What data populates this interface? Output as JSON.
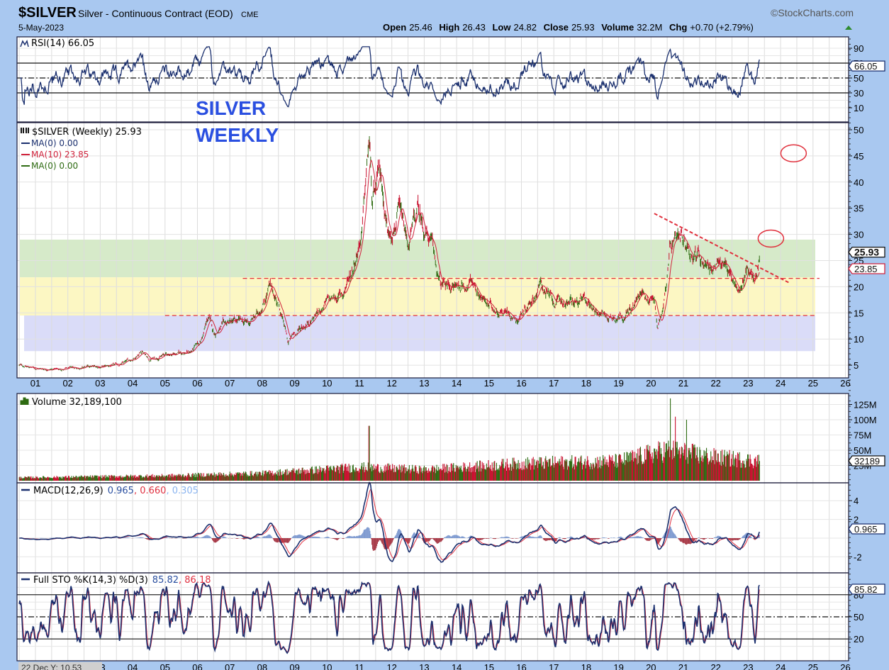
{
  "header": {
    "symbol": "$SILVER",
    "name": "Silver - Continuous Contract (EOD)",
    "exchange": "CME",
    "date": "5-May-2023",
    "copyright": "©StockCharts.com",
    "open_label": "Open",
    "open": "25.46",
    "high_label": "High",
    "high": "26.43",
    "low_label": "Low",
    "low": "24.82",
    "close_label": "Close",
    "close": "25.93",
    "volume_label": "Volume",
    "volume": "32.2M",
    "chg_label": "Chg",
    "chg": "+0.70 (+2.79%)"
  },
  "annotation": {
    "line1": "SILVER",
    "line2": "WEEKLY"
  },
  "legends": {
    "rsi": "RSI(14) 66.05",
    "price": "$SILVER (Weekly) 25.93",
    "ma1": "MA(0) 0.00",
    "ma2": "MA(10) 23.85",
    "ma3": "MA(0) 0.00",
    "volume": "Volume 32,189,100",
    "macd_name": "MACD(12,26,9)",
    "macd_v1": "0.965",
    "macd_v2": ", 0.660",
    "macd_v3": ", 0.305",
    "sto_name": "Full STO %K(14,3) %D(3)",
    "sto_k": "85.82",
    "sto_d": ", 86.18"
  },
  "tags": {
    "rsi": "66.05",
    "close": "25.93",
    "ma10": "23.85",
    "volume": "32189",
    "macd": "0.965",
    "sto": "85.82"
  },
  "cursor_readout": "22 Dec Y: 10.53",
  "colors": {
    "background": "#a9c8f0",
    "up": "#2e6b12",
    "down": "#c8102e",
    "line": "#1a2f6e",
    "ma10": "#d0233c",
    "green_zone": "#cfe6bf",
    "yellow_zone": "#fbf6b8",
    "blue_zone": "#d4d6f7",
    "annotation": "#2a4fe0"
  },
  "chart_data": [
    {
      "type": "line",
      "title": "RSI(14)",
      "yticks": [
        "90",
        "70",
        "50",
        "30",
        "10"
      ],
      "ylim": [
        0,
        100
      ],
      "reference_lines": [
        70,
        50,
        30
      ],
      "last": 66.05
    },
    {
      "type": "ohlc",
      "title": "$SILVER (Weekly)",
      "x_tick_labels": [
        "01",
        "02",
        "03",
        "04",
        "05",
        "06",
        "07",
        "08",
        "09",
        "10",
        "11",
        "12",
        "13",
        "14",
        "15",
        "16",
        "17",
        "18",
        "19",
        "20",
        "21",
        "22",
        "23",
        "24",
        "25",
        "26"
      ],
      "x_tick_years": [
        2001,
        2002,
        2003,
        2004,
        2005,
        2006,
        2007,
        2008,
        2009,
        2010,
        2011,
        2012,
        2013,
        2014,
        2015,
        2016,
        2017,
        2018,
        2019,
        2020,
        2021,
        2022,
        2023,
        2024,
        2025,
        2026
      ],
      "yticks": [
        50,
        45,
        40,
        35,
        30,
        25,
        20,
        15,
        10,
        5
      ],
      "ylim": [
        2.5,
        51.5
      ],
      "close_anchor_points": [
        [
          2000.5,
          5.0
        ],
        [
          2001.0,
          4.4
        ],
        [
          2001.8,
          4.2
        ],
        [
          2002.5,
          4.6
        ],
        [
          2003.0,
          4.7
        ],
        [
          2003.6,
          5.0
        ],
        [
          2004.0,
          6.2
        ],
        [
          2004.3,
          8.0
        ],
        [
          2004.5,
          6.0
        ],
        [
          2005.0,
          7.0
        ],
        [
          2005.8,
          7.6
        ],
        [
          2006.1,
          9.5
        ],
        [
          2006.35,
          14.2
        ],
        [
          2006.5,
          11.0
        ],
        [
          2007.0,
          13.2
        ],
        [
          2007.6,
          13.0
        ],
        [
          2007.9,
          15.0
        ],
        [
          2008.2,
          20.0
        ],
        [
          2008.5,
          17.0
        ],
        [
          2008.8,
          9.2
        ],
        [
          2009.0,
          11.0
        ],
        [
          2009.5,
          13.8
        ],
        [
          2010.0,
          17.0
        ],
        [
          2010.5,
          18.6
        ],
        [
          2010.8,
          24.0
        ],
        [
          2011.0,
          29.0
        ],
        [
          2011.1,
          32.0
        ],
        [
          2011.3,
          48.0
        ],
        [
          2011.4,
          35.0
        ],
        [
          2011.65,
          41.0
        ],
        [
          2011.9,
          30.0
        ],
        [
          2012.2,
          34.5
        ],
        [
          2012.5,
          27.5
        ],
        [
          2012.8,
          34.0
        ],
        [
          2013.2,
          28.5
        ],
        [
          2013.5,
          20.0
        ],
        [
          2014.0,
          20.0
        ],
        [
          2014.5,
          21.0
        ],
        [
          2015.0,
          16.0
        ],
        [
          2015.5,
          15.5
        ],
        [
          2015.9,
          14.0
        ],
        [
          2016.6,
          20.5
        ],
        [
          2017.0,
          16.8
        ],
        [
          2017.5,
          17.0
        ],
        [
          2018.0,
          17.0
        ],
        [
          2018.7,
          14.2
        ],
        [
          2019.3,
          15.0
        ],
        [
          2019.7,
          18.5
        ],
        [
          2020.1,
          18.0
        ],
        [
          2020.2,
          12.0
        ],
        [
          2020.4,
          17.5
        ],
        [
          2020.6,
          27.0
        ],
        [
          2021.1,
          27.5
        ],
        [
          2021.5,
          26.0
        ],
        [
          2022.0,
          23.0
        ],
        [
          2022.3,
          25.0
        ],
        [
          2022.7,
          18.5
        ],
        [
          2022.95,
          23.5
        ],
        [
          2023.1,
          23.5
        ],
        [
          2023.2,
          20.5
        ],
        [
          2023.35,
          25.93
        ]
      ],
      "last_close": 25.93,
      "ma10_last": 23.85,
      "zones": [
        {
          "name": "green",
          "from": 21.8,
          "to": 29.0
        },
        {
          "name": "yellow",
          "from": 14.5,
          "to": 21.8
        },
        {
          "name": "blue",
          "from": 7.7,
          "to": 14.5
        }
      ],
      "horizontal_lines": [
        {
          "value": 21.6,
          "from_year": 2007.4,
          "to_year": 2025.2
        },
        {
          "value": 14.5,
          "from_year": 2005.0,
          "to_year": 2025.1
        }
      ],
      "trendline": {
        "from": [
          2020.1,
          34.0
        ],
        "to": [
          2024.25,
          20.8
        ]
      },
      "target_circles": [
        [
          2024.4,
          45.5
        ],
        [
          2023.7,
          29.2
        ]
      ]
    },
    {
      "type": "bar",
      "title": "Volume",
      "yticks": [
        "125M",
        "100M",
        "75M",
        "50M",
        "25M"
      ],
      "ytick_values": [
        125,
        100,
        75,
        50,
        25
      ],
      "unit": "M",
      "volume_anchor_points": [
        [
          2000.5,
          5
        ],
        [
          2005,
          8
        ],
        [
          2008,
          12
        ],
        [
          2011,
          22
        ],
        [
          2013,
          18
        ],
        [
          2016,
          28
        ],
        [
          2019,
          32
        ],
        [
          2020.5,
          50
        ],
        [
          2022,
          38
        ],
        [
          2023.35,
          32
        ]
      ],
      "spikes": [
        [
          2011.3,
          90
        ],
        [
          2020.6,
          135
        ],
        [
          2020.75,
          105
        ],
        [
          2021.1,
          100
        ]
      ],
      "last": 32.1891
    },
    {
      "type": "line",
      "title": "MACD(12,26,9)",
      "yticks": [
        "4",
        "2",
        "-2"
      ],
      "ytick_values": [
        4,
        2,
        -2
      ],
      "last": [
        0.965,
        0.66,
        0.305
      ]
    },
    {
      "type": "line",
      "title": "Full STO %K(14,3) %D(3)",
      "yticks": [
        "80",
        "50",
        "20"
      ],
      "ytick_values": [
        80,
        50,
        20
      ],
      "reference_lines": [
        80,
        50,
        20
      ],
      "last": [
        85.82,
        86.18
      ]
    }
  ]
}
